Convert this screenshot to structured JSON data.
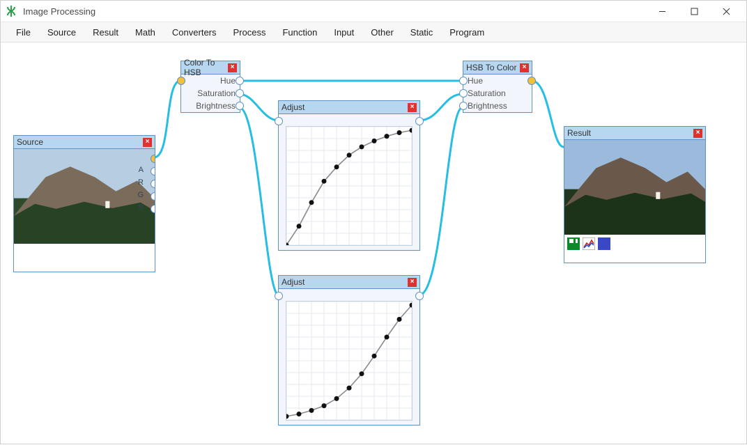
{
  "window": {
    "title": "Image Processing"
  },
  "menu": [
    "File",
    "Source",
    "Result",
    "Math",
    "Converters",
    "Process",
    "Function",
    "Input",
    "Other",
    "Static",
    "Program"
  ],
  "nodes": {
    "source": {
      "title": "Source",
      "channels": [
        "A",
        "R",
        "G",
        "B"
      ]
    },
    "colorToHSB": {
      "title": "Color To HSB",
      "outs": [
        "Hue",
        "Saturation",
        "Brightness"
      ]
    },
    "adjust1": {
      "title": "Adjust"
    },
    "adjust2": {
      "title": "Adjust"
    },
    "hsbToColor": {
      "title": "HSB To Color",
      "ins": [
        "Hue",
        "Saturation",
        "Brightness"
      ]
    },
    "result": {
      "title": "Result"
    }
  },
  "chart_data": [
    {
      "type": "line",
      "title": "Adjust",
      "xlabel": "",
      "ylabel": "",
      "xlim": [
        0,
        10
      ],
      "ylim": [
        0,
        10
      ],
      "x": [
        0,
        1,
        2,
        3,
        4,
        5,
        6,
        7,
        8,
        9,
        10
      ],
      "values": [
        0.0,
        1.6,
        3.6,
        5.4,
        6.6,
        7.6,
        8.3,
        8.8,
        9.2,
        9.5,
        9.7
      ]
    },
    {
      "type": "line",
      "title": "Adjust",
      "xlabel": "",
      "ylabel": "",
      "xlim": [
        0,
        10
      ],
      "ylim": [
        0,
        10
      ],
      "x": [
        0,
        1,
        2,
        3,
        4,
        5,
        6,
        7,
        8,
        9,
        10
      ],
      "values": [
        0.3,
        0.5,
        0.8,
        1.2,
        1.8,
        2.7,
        3.9,
        5.4,
        7.0,
        8.5,
        9.7
      ]
    }
  ],
  "colors": {
    "wire": "#27bee3",
    "nodeHeader": "#b7d7f0",
    "nodeBorder": "#6092c4"
  }
}
